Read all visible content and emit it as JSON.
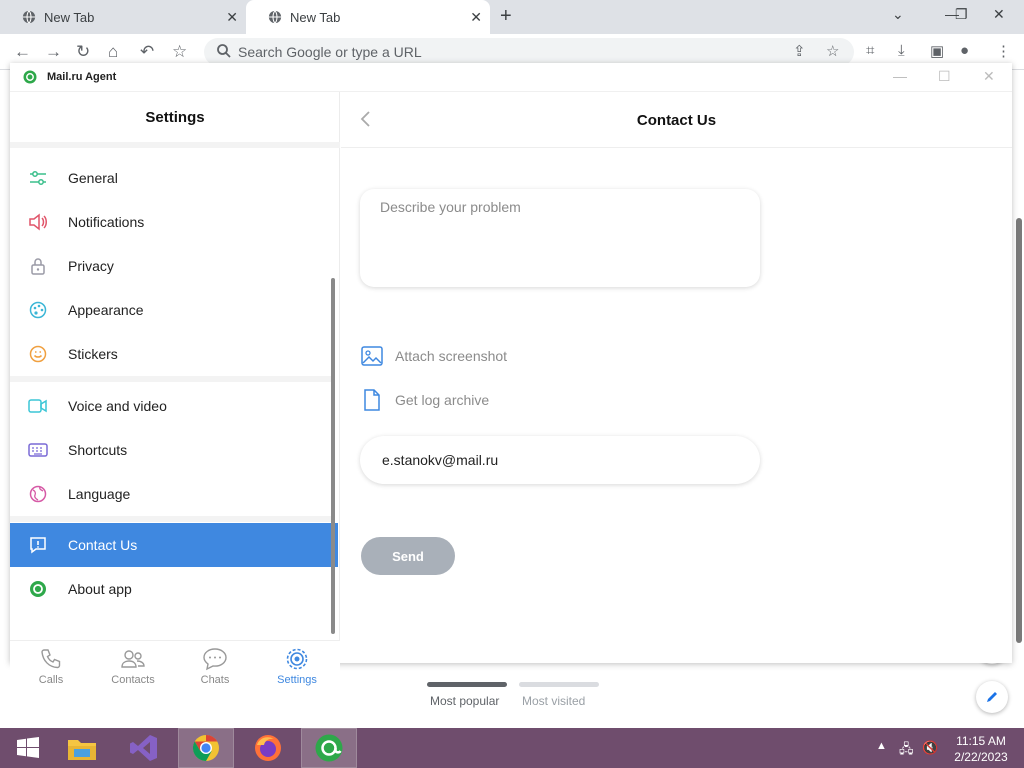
{
  "browser": {
    "tabs": [
      {
        "label": "New Tab"
      },
      {
        "label": "New Tab"
      }
    ],
    "omnibox_placeholder": "Search Google or type a URL",
    "ntp": {
      "tab_popular": "Most popular",
      "tab_visited": "Most visited"
    }
  },
  "app": {
    "title": "Mail.ru Agent",
    "accent_color": "#3f88e0",
    "sidebar": {
      "title": "Settings",
      "items": [
        {
          "label": "General",
          "icon": "sliders-icon"
        },
        {
          "label": "Notifications",
          "icon": "speaker-icon"
        },
        {
          "label": "Privacy",
          "icon": "lock-icon"
        },
        {
          "label": "Appearance",
          "icon": "palette-icon"
        },
        {
          "label": "Stickers",
          "icon": "smiley-icon"
        },
        {
          "label": "Voice and video",
          "icon": "camera-icon"
        },
        {
          "label": "Shortcuts",
          "icon": "keyboard-icon"
        },
        {
          "label": "Language",
          "icon": "globe-icon"
        },
        {
          "label": "Contact Us",
          "icon": "message-alert-icon",
          "active": true
        },
        {
          "label": "About app",
          "icon": "agent-logo-icon"
        }
      ]
    },
    "bottom_nav": [
      {
        "label": "Calls",
        "icon": "phone-icon"
      },
      {
        "label": "Contacts",
        "icon": "contacts-icon"
      },
      {
        "label": "Chats",
        "icon": "chat-bubble-icon"
      },
      {
        "label": "Settings",
        "icon": "gear-icon",
        "active": true
      }
    ],
    "contact": {
      "title": "Contact Us",
      "problem_placeholder": "Describe your problem",
      "problem_value": "",
      "attach_label": "Attach screenshot",
      "log_label": "Get log archive",
      "email_value": "e.stanokv@mail.ru",
      "send_label": "Send"
    }
  },
  "taskbar": {
    "time": "11:15 AM",
    "date": "2/22/2023"
  }
}
